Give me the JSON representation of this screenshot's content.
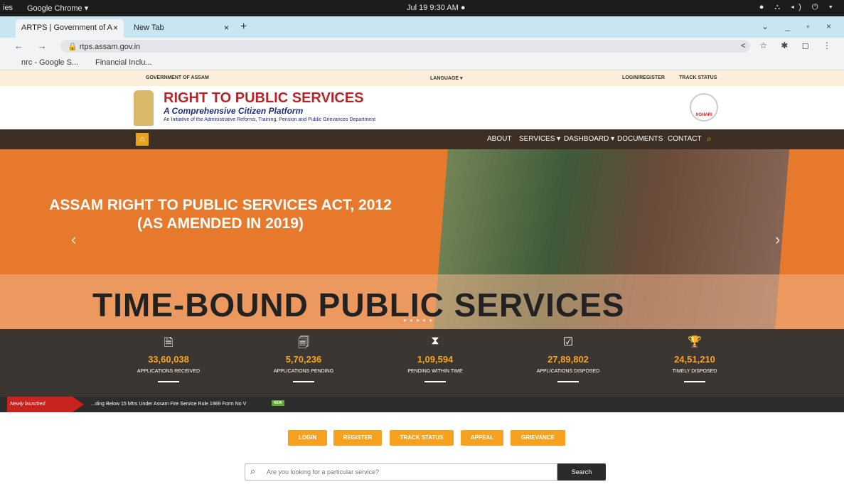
{
  "os": {
    "left_fragment": "ies",
    "app_menu": "Google Chrome ▾",
    "clock": "Jul 19  9:30 AM  ●",
    "tray": "● ⛬ ◂) ⏻ ▾"
  },
  "browser": {
    "tabs": [
      {
        "label": "ARTPS | Government of A",
        "close": "×"
      },
      {
        "label": "New Tab",
        "close": "×"
      }
    ],
    "new_tab": "+",
    "nav": "←  →  C",
    "url": "rtps.assam.gov.in",
    "bookmarks": [
      "nrc - Google S...",
      "Financial Inclu..."
    ],
    "window_controls": "⌄ _ ▫ ×",
    "ext": "< ☆ ✱ ◻ ⋮"
  },
  "topstrip": {
    "gov": "GOVERNMENT OF ASSAM",
    "language": "LANGUAGE ▾",
    "login": "LOGIN/REGISTER",
    "track": "TRACK STATUS"
  },
  "header": {
    "title": "RIGHT TO PUBLIC SERVICES",
    "tagline": "A Comprehensive Citizen Platform",
    "subtitle": "An Initiative of the Administrative Reforms, Training, Pension and Public Grievances Department",
    "logo_text": "XOHARI"
  },
  "nav": {
    "items": [
      "ABOUT",
      "SERVICES ▾",
      "DASHBOARD ▾",
      "DOCUMENTS",
      "CONTACT"
    ]
  },
  "hero": {
    "headline": "ASSAM RIGHT TO PUBLIC SERVICES ACT, 2012",
    "headline2": "(AS AMENDED IN 2019)",
    "banner": "TIME-BOUND PUBLIC SERVICES",
    "prev": "‹",
    "next": "›",
    "dots": "● ● ● ● ●"
  },
  "stats": [
    {
      "icon": "🗎",
      "value": "33,60,038",
      "label": "APPLICATIONS RECEIVED"
    },
    {
      "icon": "🗐",
      "value": "5,70,236",
      "label": "APPLICATIONS PENDING"
    },
    {
      "icon": "⧗",
      "value": "1,09,594",
      "label": "PENDING WITHIN TIME"
    },
    {
      "icon": "☑",
      "value": "27,89,802",
      "label": "APPLICATIONS DISPOSED"
    },
    {
      "icon": "🏆",
      "value": "24,51,210",
      "label": "TIMELY DISPOSED"
    }
  ],
  "ticker": {
    "label": "Newly launched",
    "text": "...ding Below 15 Mtrs Under Assam Fire Service Rule 1989 Form No V",
    "badge": "NEW"
  },
  "actions": [
    "LOGIN",
    "REGISTER",
    "TRACK STATUS",
    "APPEAL",
    "GRIEVANCE"
  ],
  "search": {
    "placeholder": "Are you looking for a particular service?",
    "button": "Search"
  },
  "colors": {
    "accent": "#f6a21e",
    "brand_red": "#b7252b",
    "nav_bg": "#3d2f24",
    "hero_orange": "#e6792b"
  }
}
